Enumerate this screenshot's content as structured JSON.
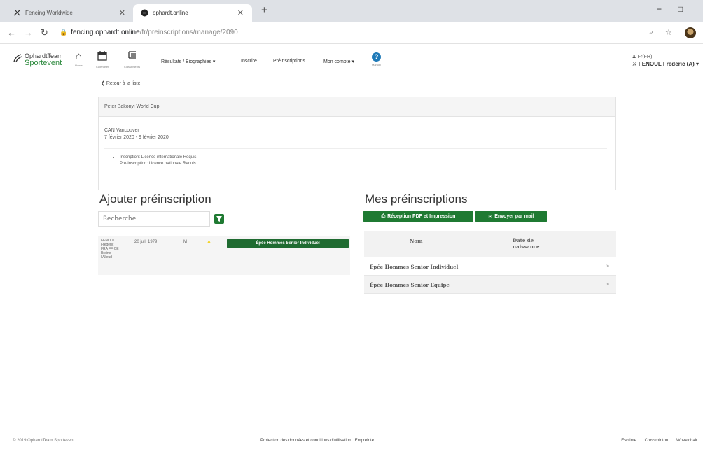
{
  "browser": {
    "tabs": [
      {
        "title": "Fencing Worldwide",
        "icon": "fencing-icon"
      },
      {
        "title": "ophardt.online",
        "icon": "ophardt-icon"
      }
    ],
    "new_tab": "+",
    "url_host": "fencing.ophardt.online",
    "url_path": "/fr/preinscriptions/manage/2090",
    "window": {
      "minimize": "−",
      "maximize": "□"
    }
  },
  "header": {
    "logo_line1": "OphardtTeam",
    "logo_line2": "Sportevent",
    "icons": [
      {
        "name": "home",
        "caption": "Home"
      },
      {
        "name": "calendar",
        "caption": "Calendrier"
      },
      {
        "name": "rankings",
        "caption": "Classements"
      }
    ],
    "menu": [
      "Résultats / Biographies ▾",
      "Inscrire",
      "Préinscriptions",
      "Mon compte ▾"
    ],
    "help_caption": "Manuel",
    "user_role": "Fr(FH)",
    "user_name": "FENOUL Frederic (A) ▾"
  },
  "back_link": "Retour à la liste",
  "event": {
    "title": "Peter Bakonyi World Cup",
    "club": "CAN Vancouver",
    "dates": "7 février 2020 - 9 février 2020",
    "requirements": [
      "Inscription: Licence internationale Requis",
      "Pre-inscription: Licence nationale Requis"
    ]
  },
  "add": {
    "heading": "Ajouter préinscription",
    "search_placeholder": "Recherche",
    "result": {
      "fencer_lines": [
        "FENOUL",
        "Frederic",
        "FRA FF CE",
        "Breine",
        "l'Alleud"
      ],
      "birth": "20 juil. 1979",
      "sex": "M",
      "category_button": "Épée Hommes Senior Individuel"
    }
  },
  "mine": {
    "heading": "Mes préinscriptions",
    "pdf_button": "Réception PDF et Impression",
    "mail_button": "Envoyer par mail",
    "col_name": "Nom",
    "col_birth_line1": "Date de",
    "col_birth_line2": "naissance",
    "rows": [
      {
        "name": "Épée Hommes Senior Individuel",
        "action": "»"
      },
      {
        "name": "Épée Hommes Senior Equipe",
        "action": "»"
      }
    ]
  },
  "footer": {
    "copyright": "© 2019 OphardtTeam Sportevent",
    "privacy": "Protection des données et conditions d'utilisation",
    "imprint": "Empreinte",
    "links": [
      "Escrime",
      "Crossminton",
      "Wheelchair"
    ]
  },
  "colors": {
    "accent_green": "#1f7a32",
    "logo_green": "#2d8a3e",
    "help_blue": "#1f7ab8",
    "star_yellow": "#f2d42a"
  }
}
